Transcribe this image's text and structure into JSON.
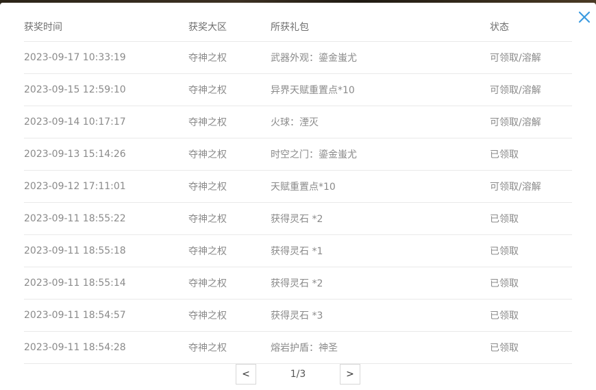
{
  "header": {
    "time": "获奖时间",
    "zone": "获奖大区",
    "gift": "所获礼包",
    "status": "状态"
  },
  "rows": [
    {
      "time": "2023-09-17 10:33:19",
      "zone": "夺神之权",
      "gift": "武器外观：鎏金蚩尤",
      "status": "可领取/溶解"
    },
    {
      "time": "2023-09-15 12:59:10",
      "zone": "夺神之权",
      "gift": "异界天赋重置点*10",
      "status": "可领取/溶解"
    },
    {
      "time": "2023-09-14 10:17:17",
      "zone": "夺神之权",
      "gift": "火球：湮灭",
      "status": "可领取/溶解"
    },
    {
      "time": "2023-09-13 15:14:26",
      "zone": "夺神之权",
      "gift": "时空之门：鎏金蚩尤",
      "status": "已领取"
    },
    {
      "time": "2023-09-12 17:11:01",
      "zone": "夺神之权",
      "gift": "天赋重置点*10",
      "status": "可领取/溶解"
    },
    {
      "time": "2023-09-11 18:55:22",
      "zone": "夺神之权",
      "gift": "获得灵石 *2",
      "status": "已领取"
    },
    {
      "time": "2023-09-11 18:55:18",
      "zone": "夺神之权",
      "gift": "获得灵石 *1",
      "status": "已领取"
    },
    {
      "time": "2023-09-11 18:55:14",
      "zone": "夺神之权",
      "gift": "获得灵石 *2",
      "status": "已领取"
    },
    {
      "time": "2023-09-11 18:54:57",
      "zone": "夺神之权",
      "gift": "获得灵石 *3",
      "status": "已领取"
    },
    {
      "time": "2023-09-11 18:54:28",
      "zone": "夺神之权",
      "gift": "熔岩护盾：神圣",
      "status": "已领取"
    }
  ],
  "pagination": {
    "prev": "<",
    "next": ">",
    "info": "1/3"
  },
  "icons": {
    "close": "close-icon"
  },
  "colors": {
    "close": "#3a9ae0"
  }
}
